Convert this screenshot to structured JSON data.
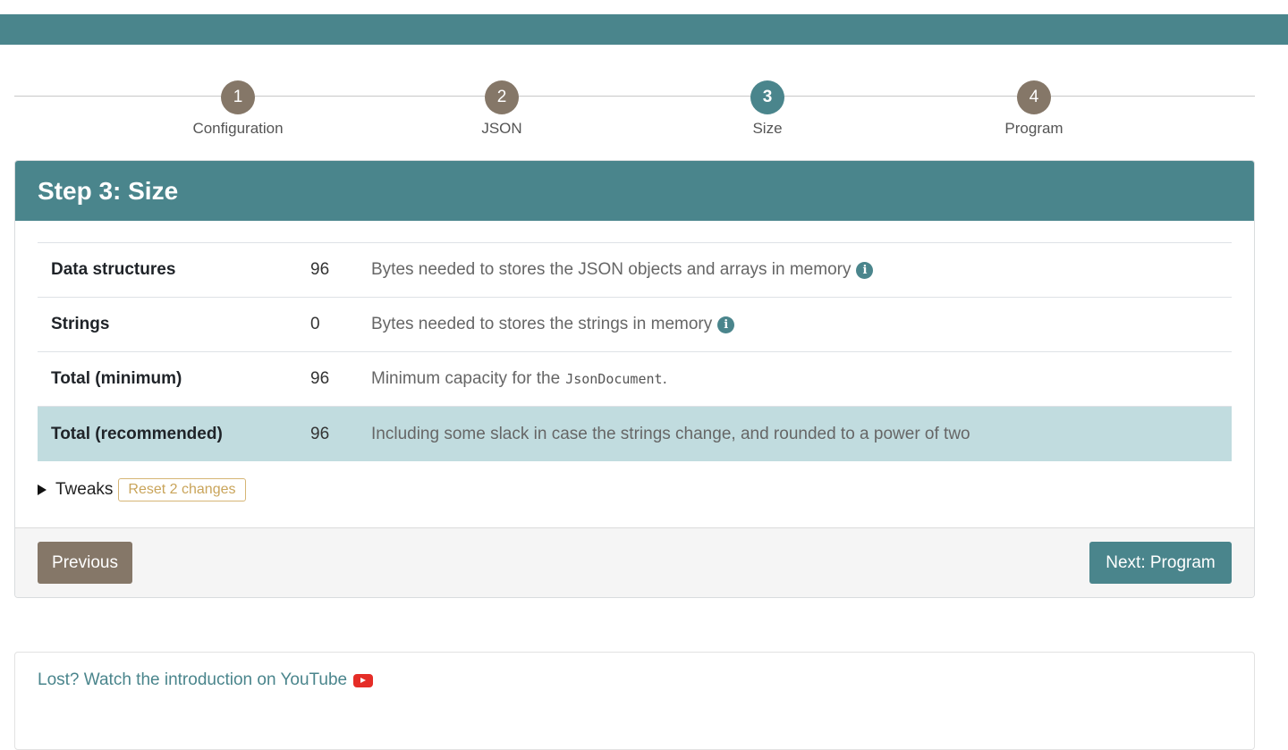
{
  "stepper": {
    "steps": [
      {
        "number": "1",
        "label": "Configuration"
      },
      {
        "number": "2",
        "label": "JSON"
      },
      {
        "number": "3",
        "label": "Size"
      },
      {
        "number": "4",
        "label": "Program"
      }
    ],
    "active_step": 3
  },
  "card": {
    "title": "Step 3: Size",
    "rows": [
      {
        "label": "Data structures",
        "value": "96",
        "description": "Bytes needed to stores the JSON objects and arrays in memory",
        "info_icon": "info-icon"
      },
      {
        "label": "Strings",
        "value": "0",
        "description": "Bytes needed to stores the strings in memory",
        "info_icon": "info-icon"
      },
      {
        "label": "Total (minimum)",
        "value": "96",
        "description": "Minimum capacity for the",
        "code": "JsonDocument",
        "suffix": "."
      },
      {
        "label": "Total (recommended)",
        "value": "96",
        "description": "Including some slack in case the strings change, and rounded to a power of two"
      }
    ],
    "tweaks_label": "Tweaks",
    "reset_label": "Reset 2 changes",
    "previous_label": "Previous",
    "next_label": "Next: Program"
  },
  "help": {
    "text": "Lost? Watch the introduction on YouTube",
    "icon": "youtube-icon"
  },
  "colors": {
    "accent": "#4a858c",
    "secondary": "#857768",
    "highlight_row": "#c1dcdf",
    "reset": "#c9a45a"
  }
}
